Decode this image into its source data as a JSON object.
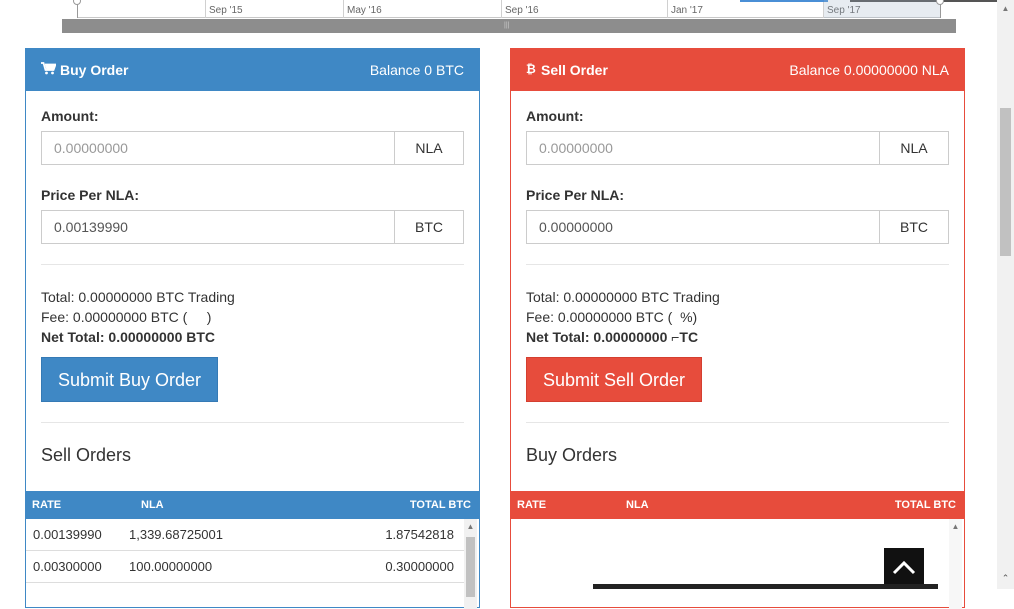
{
  "navigator": {
    "ticks": [
      "Sep '15",
      "May '16",
      "Sep '16",
      "Jan '17",
      "Sep '17"
    ],
    "grip": "|||"
  },
  "buy": {
    "title": "Buy Order",
    "balance": "Balance 0 BTC",
    "amount_label": "Amount:",
    "amount_placeholder": "0.00000000",
    "amount_unit": "NLA",
    "price_label": "Price Per NLA:",
    "price_value": "0.00139990",
    "price_unit": "BTC",
    "total": "Total: 0.00000000 BTC Trading",
    "fee": "Fee: 0.00000000 BTC (     )",
    "net_total": "Net Total: 0.00000000 BTC",
    "submit": "Submit Buy Order",
    "orders_title": "Sell Orders",
    "columns": [
      "RATE",
      "NLA",
      "TOTAL BTC"
    ],
    "rows": [
      {
        "rate": "0.00139990",
        "nla": "1,339.68725001",
        "total": "1.87542818"
      },
      {
        "rate": "0.00300000",
        "nla": "100.00000000",
        "total": "0.30000000"
      }
    ]
  },
  "sell": {
    "title": "Sell Order",
    "balance": "Balance 0.00000000 NLA",
    "amount_label": "Amount:",
    "amount_placeholder": "0.00000000",
    "amount_unit": "NLA",
    "price_label": "Price Per NLA:",
    "price_value": "0.00000000",
    "price_unit": "BTC",
    "total": "Total: 0.00000000 BTC Trading",
    "fee": "Fee: 0.00000000 BTC (  %)",
    "net_total": "Net Total: 0.00000000 ⌐TC",
    "submit": "Submit Sell Order",
    "orders_title": "Buy Orders",
    "columns": [
      "RATE",
      "NLA",
      "TOTAL BTC"
    ]
  },
  "colors": {
    "buy_accent": "#3f88c5",
    "sell_accent": "#e74c3c"
  },
  "icons": {
    "buy": "cart-icon",
    "sell": "bitcoin-icon",
    "back_to_top": "chevron-up-icon"
  }
}
